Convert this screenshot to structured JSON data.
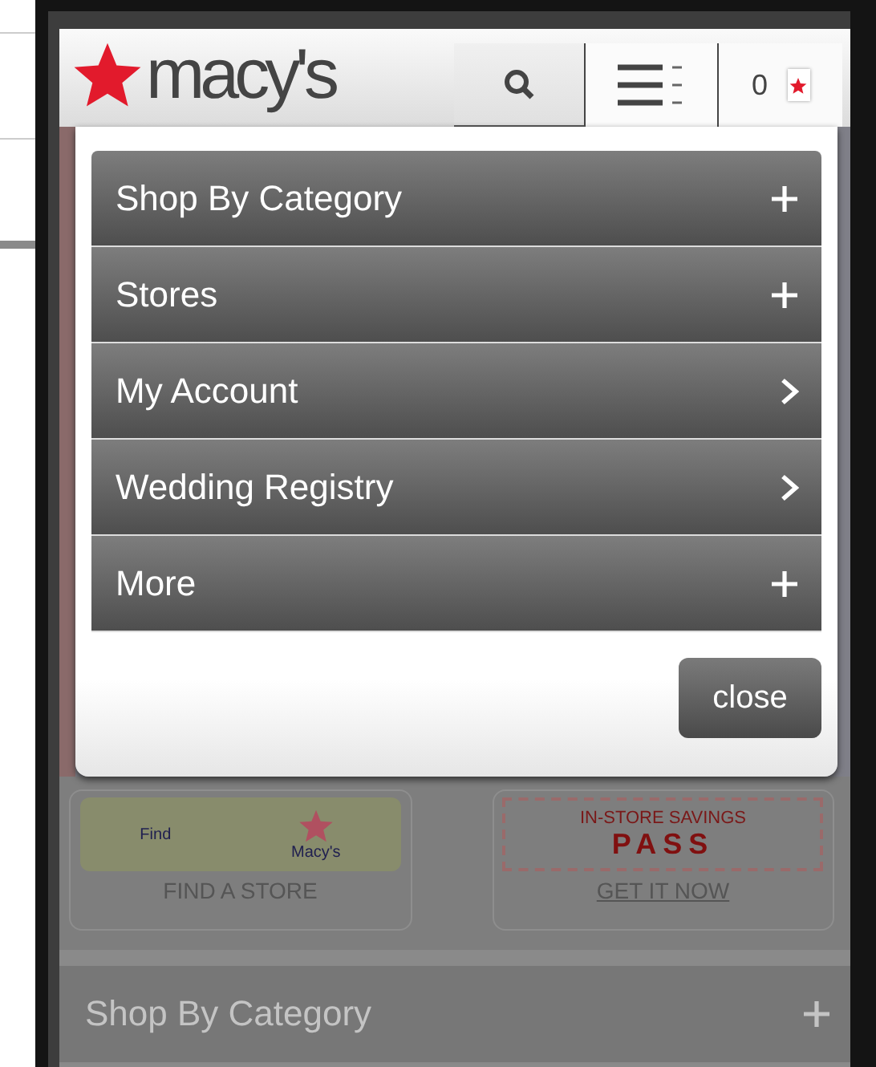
{
  "header": {
    "logo": "macy's",
    "bag_count": "0"
  },
  "menu": {
    "items": [
      {
        "label": "Shop By Category",
        "kind": "expand"
      },
      {
        "label": "Stores",
        "kind": "expand"
      },
      {
        "label": "My Account",
        "kind": "link"
      },
      {
        "label": "Wedding Registry",
        "kind": "link"
      },
      {
        "label": "More",
        "kind": "expand"
      }
    ],
    "close": "close"
  },
  "page": {
    "promos": [
      {
        "kind": "store",
        "title": "FIND A STORE",
        "small": "Find",
        "brand": "Macy's"
      },
      {
        "kind": "pass",
        "title": "GET IT NOW",
        "badge_top": "IN-STORE SAVINGS",
        "badge_main": "PASS"
      }
    ],
    "menu_row": {
      "label": "Shop By Category",
      "kind": "expand"
    }
  }
}
